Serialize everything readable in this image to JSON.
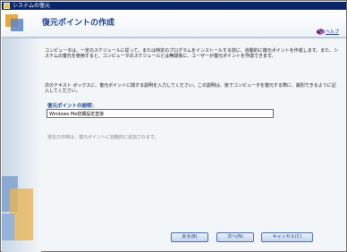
{
  "window": {
    "title": "システムの復元"
  },
  "header": {
    "title": "復元ポイントの作成",
    "help_label": "ヘルプ"
  },
  "main": {
    "intro_text": "コンピュータは、一定のスケジュールに従って、または特定のプログラムをインストールする前に、自動的に復元ポイントを作成します。また、システムの復元を使用すると、コンピュータのスケジュールとは無関係に、ユーザーが復元ポイントを作成できます。",
    "instruction_text": "次のテキスト ボックスに、復元ポイントに関する説明を入力してください。この説明は、後でコンピュータを復元する際に、識別できるように記入してください。",
    "description_label": "復元ポイントの説明：",
    "description_value": "Windows Me初期設定直後",
    "note_text": "現在の日時は、復元ポイントに自動的に追加されます。"
  },
  "footer": {
    "back_label": "戻る(B)",
    "next_label": "次へ(N)",
    "cancel_label": "キャンセル(C)"
  },
  "colors": {
    "title_bar": "#0a246a",
    "heading": "#1c3f93",
    "note": "#888888"
  }
}
